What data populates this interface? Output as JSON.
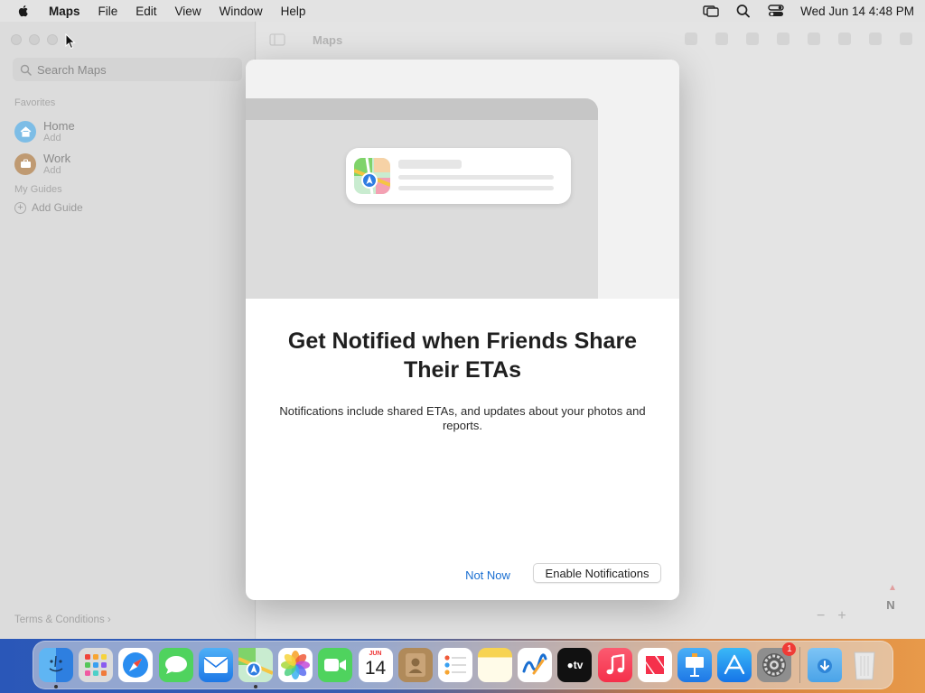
{
  "menubar": {
    "app_name": "Maps",
    "items": [
      "File",
      "Edit",
      "View",
      "Window",
      "Help"
    ],
    "clock": "Wed Jun 14  4:48 PM"
  },
  "sidebar": {
    "search_placeholder": "Search Maps",
    "favorites_label": "Favorites",
    "favorites": [
      {
        "name": "Home",
        "sub": "Add"
      },
      {
        "name": "Work",
        "sub": "Add"
      }
    ],
    "guides_label": "My Guides",
    "add_guide": "Add Guide",
    "terms": "Terms & Conditions"
  },
  "map": {
    "title": "Maps",
    "compass_label": "N",
    "zoom_out": "−",
    "zoom_in": "+"
  },
  "dialog": {
    "title": "Get Notified when Friends Share Their ETAs",
    "body": "Notifications include shared ETAs, and updates about your photos and reports.",
    "secondary_button": "Not Now",
    "primary_button": "Enable Notifications"
  },
  "dock": {
    "calendar_month": "JUN",
    "calendar_day": "14",
    "tv_label": "tv",
    "settings_badge": "1",
    "apps": [
      "finder",
      "launchpad",
      "safari",
      "messages",
      "mail",
      "maps",
      "photos",
      "facetime",
      "calendar",
      "contacts",
      "reminders",
      "notes",
      "freeform",
      "tv",
      "music",
      "news",
      "keynote",
      "app-store",
      "system-settings",
      "downloads",
      "trash"
    ]
  },
  "colors": {
    "accent": "#1a6fd1",
    "badge": "#ef3b36",
    "home_icon": "#4aa3e0",
    "work_icon": "#a2784a"
  }
}
